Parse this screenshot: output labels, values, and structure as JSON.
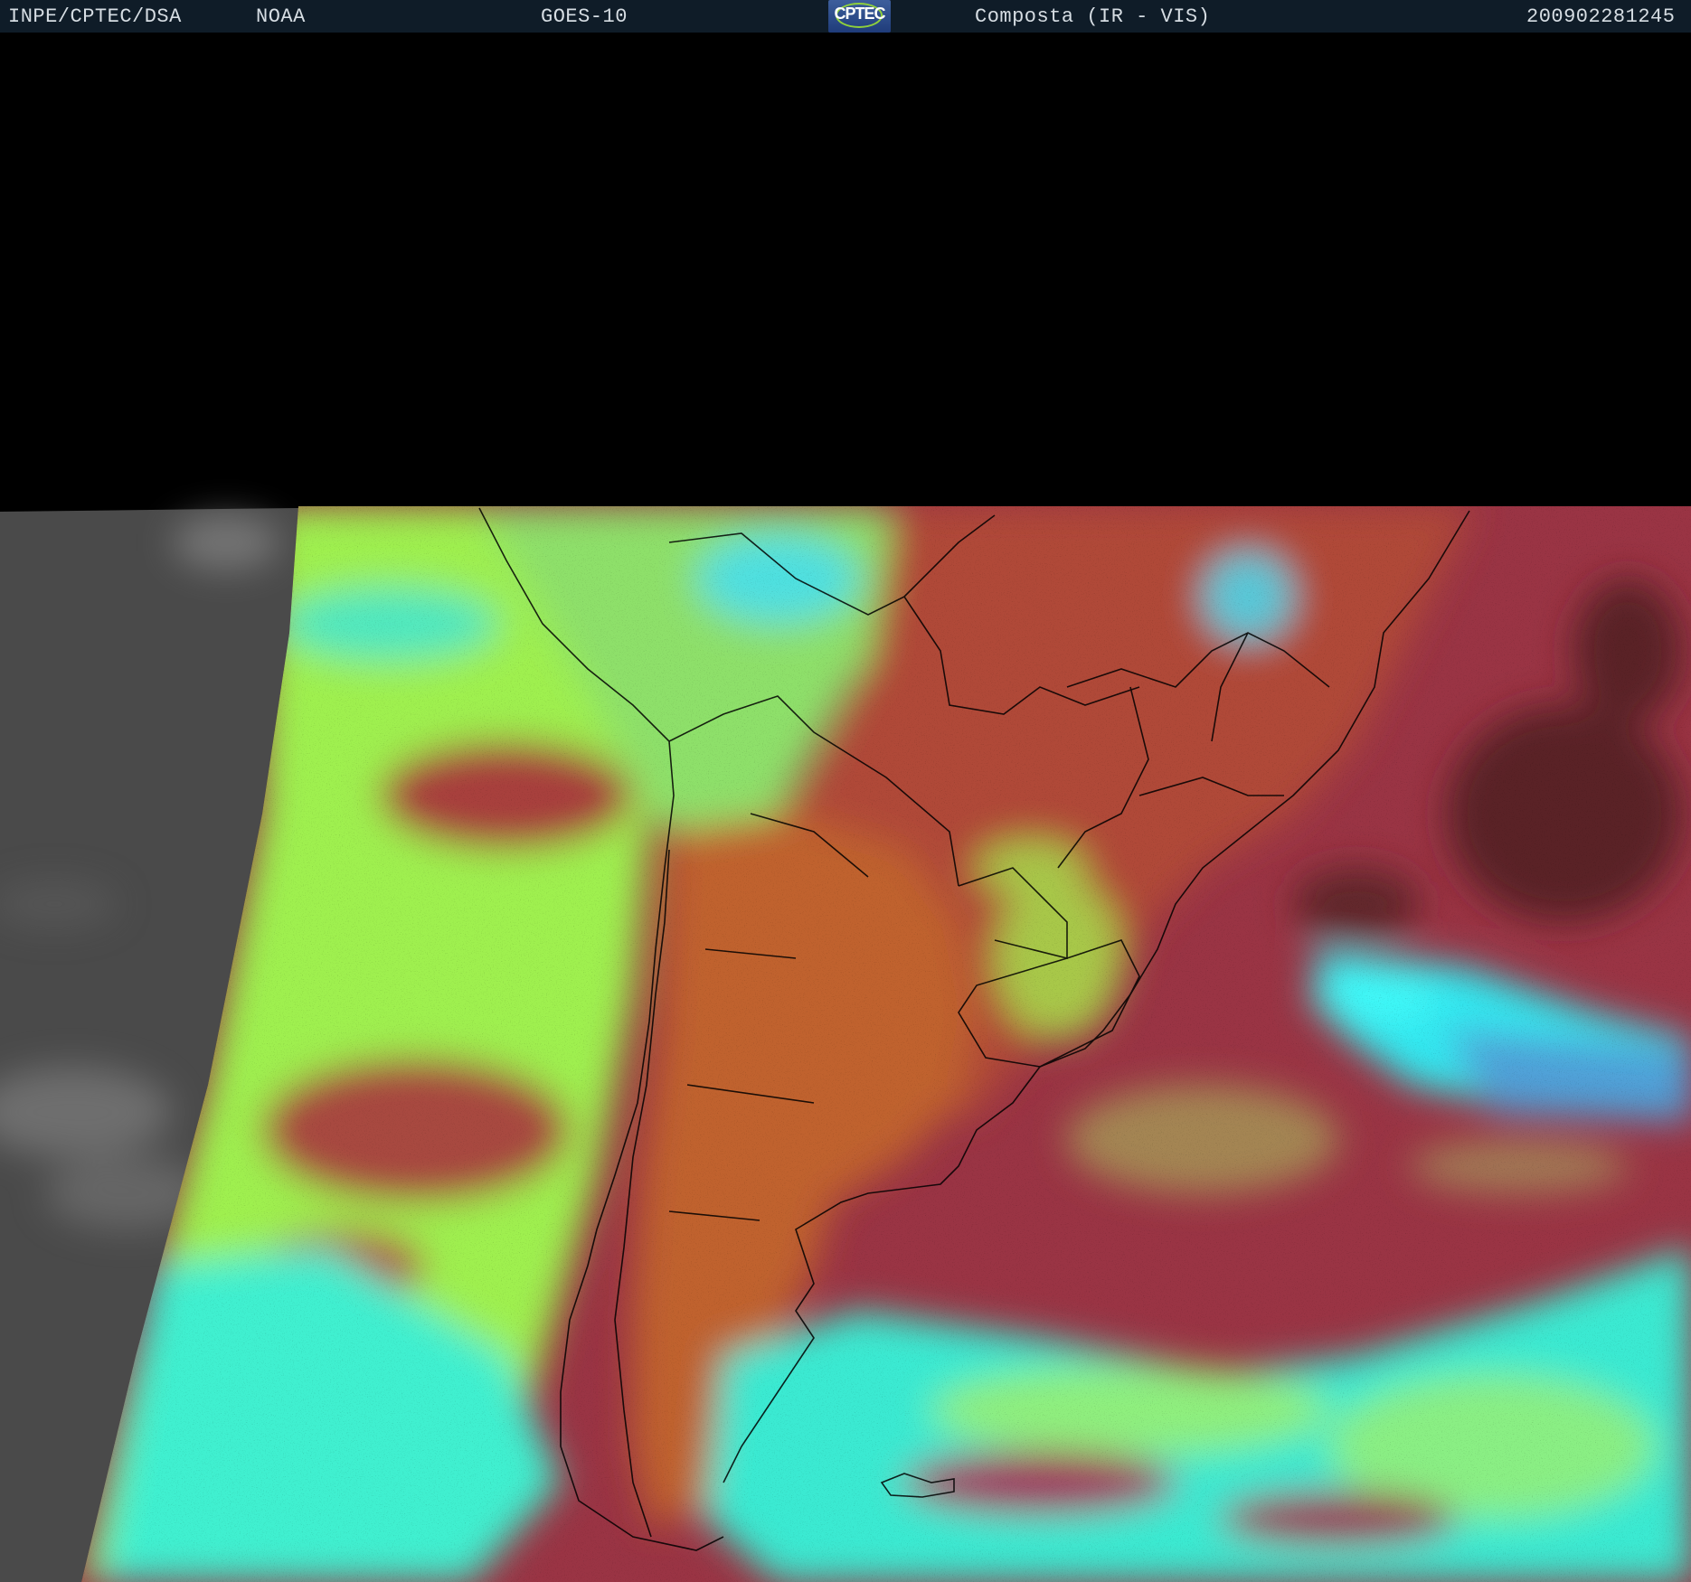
{
  "header": {
    "org": "INPE/CPTEC/DSA",
    "agency": "NOAA",
    "satellite": "GOES-10",
    "logo_text": "CPTEC",
    "product": "Composta (IR - VIS)",
    "timestamp": "200902281245"
  },
  "map": {
    "region": "South America",
    "colors": {
      "land_clear": "#b04a38",
      "ocean_clear": "#9a3444",
      "low_cloud": "#9ff050",
      "high_cloud": "#3ff0e0",
      "argentina_land": "#c0622e",
      "night_side": "#4a4a4a",
      "no_data": "#000000",
      "borders": "#000000"
    }
  }
}
